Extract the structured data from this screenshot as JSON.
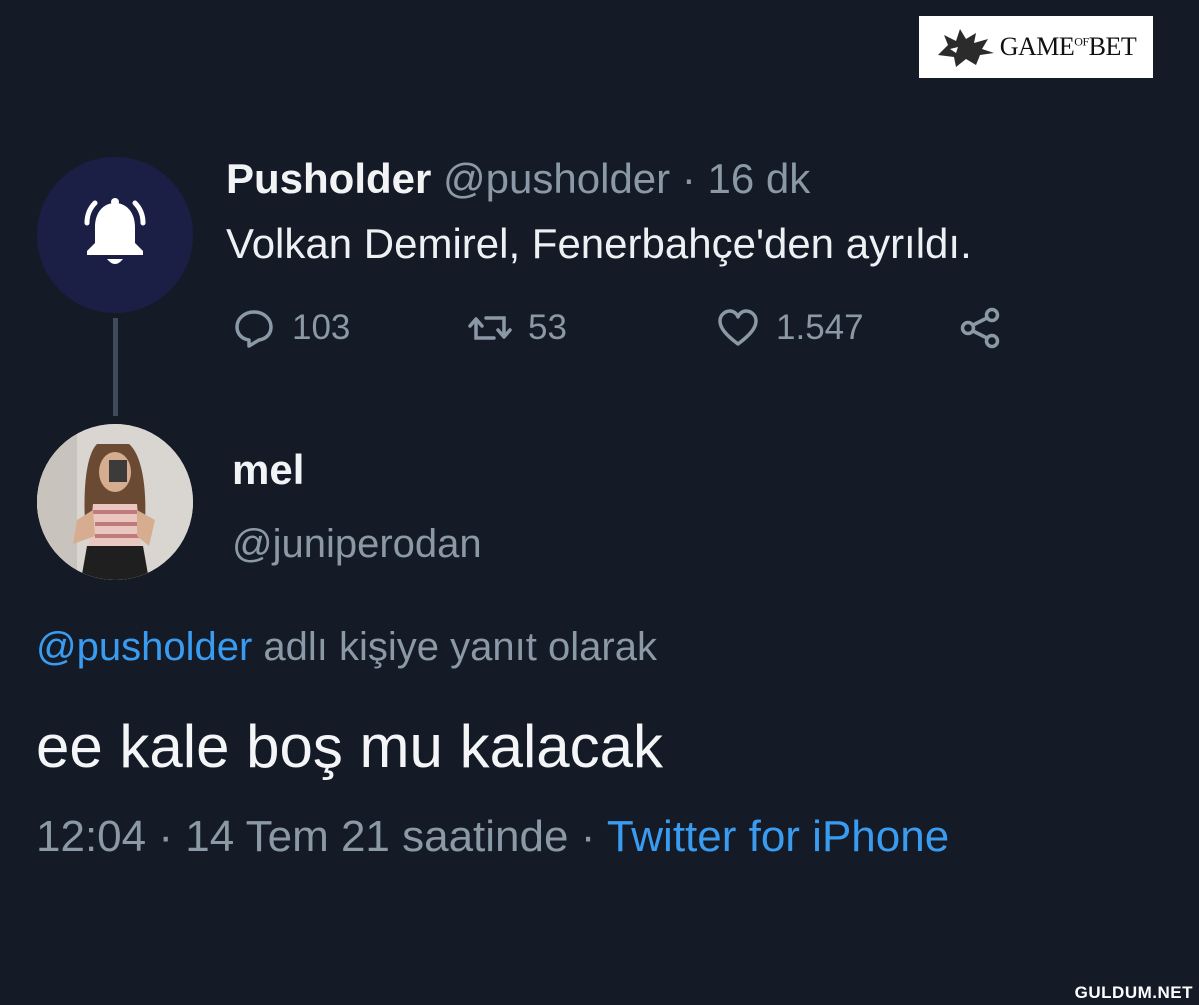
{
  "watermark_logo": {
    "text": "GAME",
    "of": "OF",
    "text2": "BET",
    "icon": "wolf-head-icon"
  },
  "tweet1": {
    "display_name": "Pusholder",
    "handle": "@pusholder",
    "separator": "·",
    "time": "16 dk",
    "text": "Volkan Demirel, Fenerbahçe'den ayrıldı.",
    "avatar_icon": "bell-icon",
    "avatar_color": "#1c1f45",
    "actions": {
      "reply_count": "103",
      "retweet_count": "53",
      "like_count": "1.547"
    }
  },
  "tweet2": {
    "display_name": "mel",
    "handle": "@juniperodan",
    "reply_to_handle": "@pusholder",
    "reply_to_suffix": "adlı kişiye yanıt olarak",
    "text": "ee kale boş mu kalacak",
    "time": "12:04",
    "separator": "·",
    "date": "14 Tem 21 saatinde",
    "separator2": "·",
    "source": "Twitter for iPhone"
  },
  "site_watermark": "GULDUM.NET",
  "colors": {
    "background": "#141b27",
    "link": "#3a9cf0",
    "muted": "#8b98a5"
  }
}
